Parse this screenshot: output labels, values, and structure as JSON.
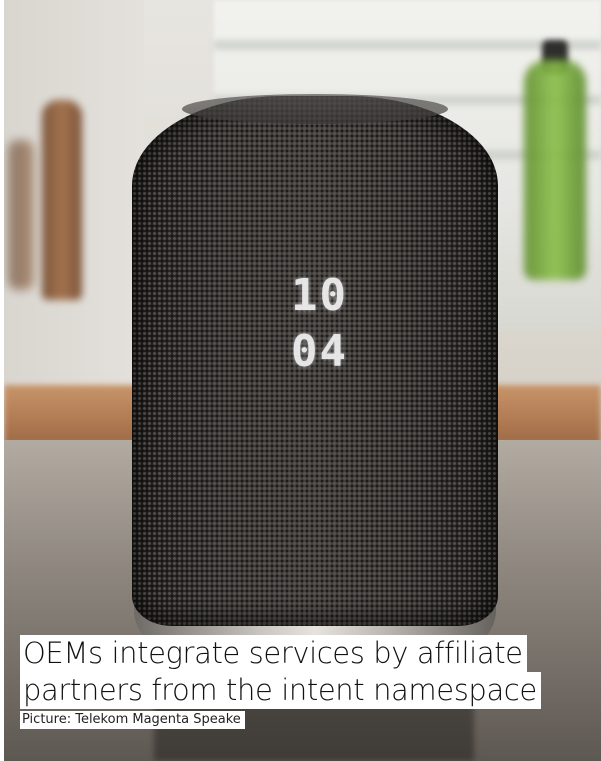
{
  "image": {
    "description_alt": "Smart speaker with fabric mesh cover and LED clock display",
    "clock": {
      "hours": "10",
      "minutes": "04"
    }
  },
  "caption": {
    "line1": "OEMs integrate services by affiliate",
    "line2": "partners from the intent namespace"
  },
  "credit": "Picture: Telekom Magenta Speake",
  "colors": {
    "speaker_fabric": "#302e2c",
    "display_led": "#f4f4f6",
    "caption_bg": "#ffffff",
    "caption_text": "#111111"
  }
}
